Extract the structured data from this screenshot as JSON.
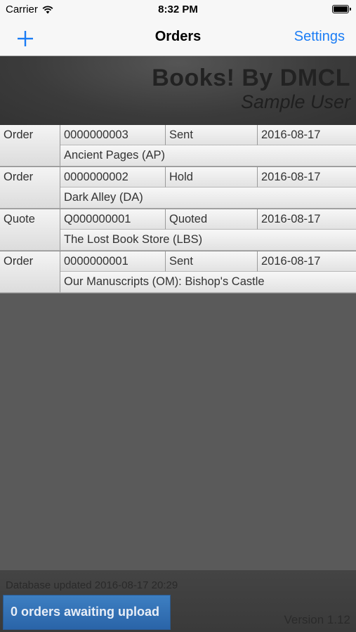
{
  "status_bar": {
    "carrier": "Carrier",
    "time": "8:32 PM"
  },
  "nav": {
    "add_label": "+",
    "title": "Orders",
    "settings_label": "Settings"
  },
  "banner": {
    "title": "Books! By DMCL",
    "user": "Sample User"
  },
  "orders": [
    {
      "type": "Order",
      "number": "0000000003",
      "status": "Sent",
      "date": "2016-08-17",
      "vendor": "Ancient Pages (AP)"
    },
    {
      "type": "Order",
      "number": "0000000002",
      "status": "Hold",
      "date": "2016-08-17",
      "vendor": "Dark Alley (DA)"
    },
    {
      "type": "Quote",
      "number": "Q000000001",
      "status": "Quoted",
      "date": "2016-08-17",
      "vendor": "The Lost Book Store (LBS)"
    },
    {
      "type": "Order",
      "number": "0000000001",
      "status": "Sent",
      "date": "2016-08-17",
      "vendor": "Our Manuscripts (OM): Bishop's Castle"
    }
  ],
  "footer": {
    "db_updated": "Database updated 2016-08-17 20:29",
    "upload_button": "0 orders awaiting upload",
    "version": "Version 1.12"
  },
  "colors": {
    "accent": "#1a7cf5",
    "upload_button": "#2f6fb3"
  }
}
